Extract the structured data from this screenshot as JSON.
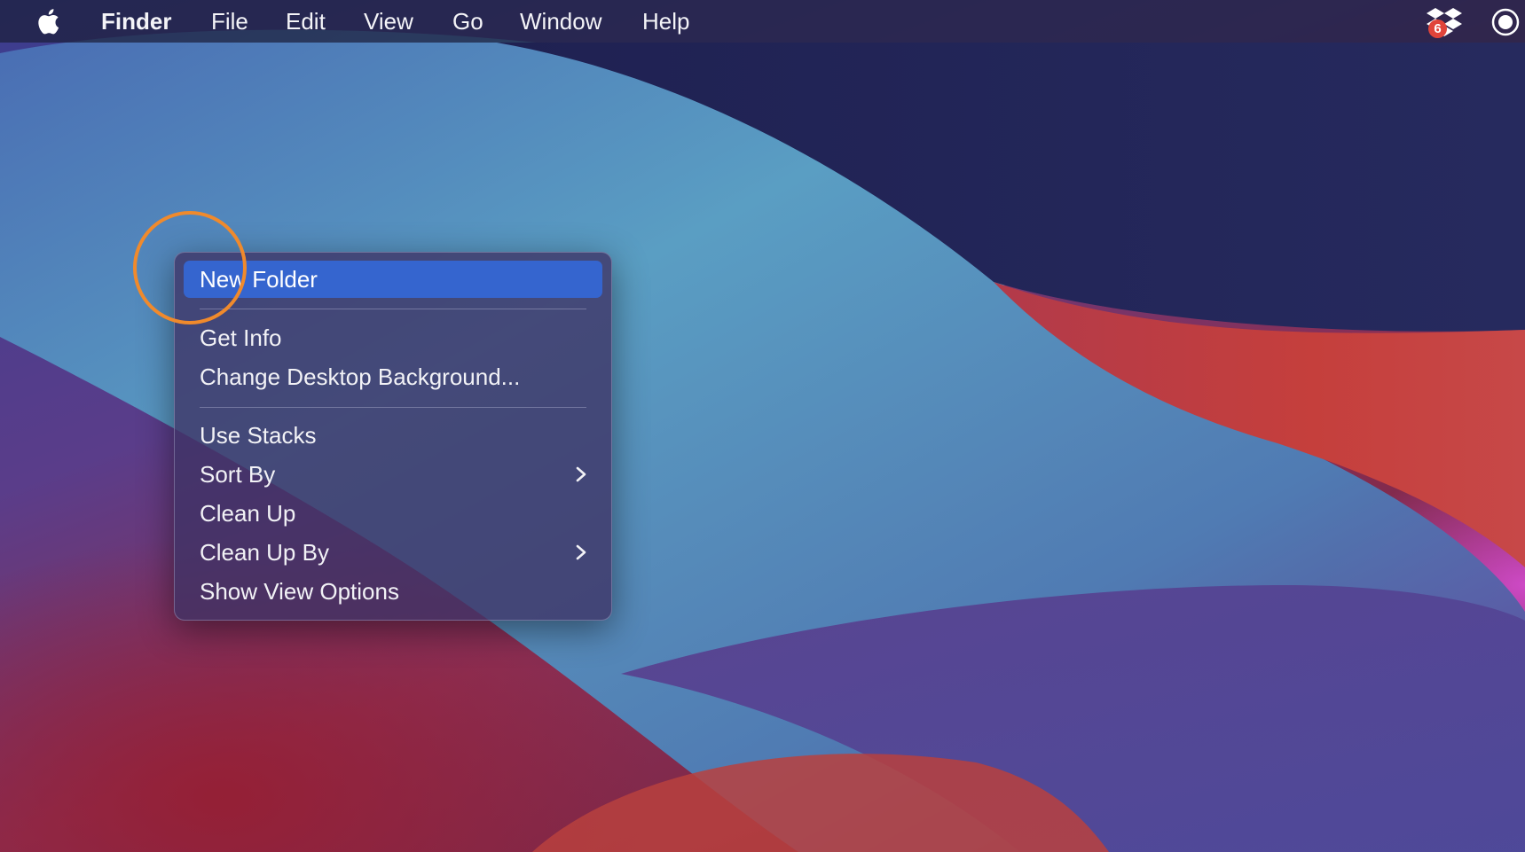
{
  "menubar": {
    "app_name": "Finder",
    "items": [
      "File",
      "Edit",
      "View",
      "Go",
      "Window",
      "Help"
    ],
    "tray": {
      "dropbox_icon": "dropbox-icon",
      "dropbox_badge": "6",
      "record_icon": "screen-record-icon"
    }
  },
  "context_menu": {
    "items": [
      {
        "label": "New Folder",
        "highlighted": true
      },
      {
        "label": "Get Info"
      },
      {
        "label": "Change Desktop Background..."
      },
      {
        "label": "Use Stacks"
      },
      {
        "label": "Sort By",
        "submenu": true
      },
      {
        "label": "Clean Up"
      },
      {
        "label": "Clean Up By",
        "submenu": true
      },
      {
        "label": "Show View Options"
      }
    ]
  },
  "colors": {
    "highlight": "#3565cf",
    "annotation": "#f08a2c",
    "badge": "#e0443a"
  }
}
